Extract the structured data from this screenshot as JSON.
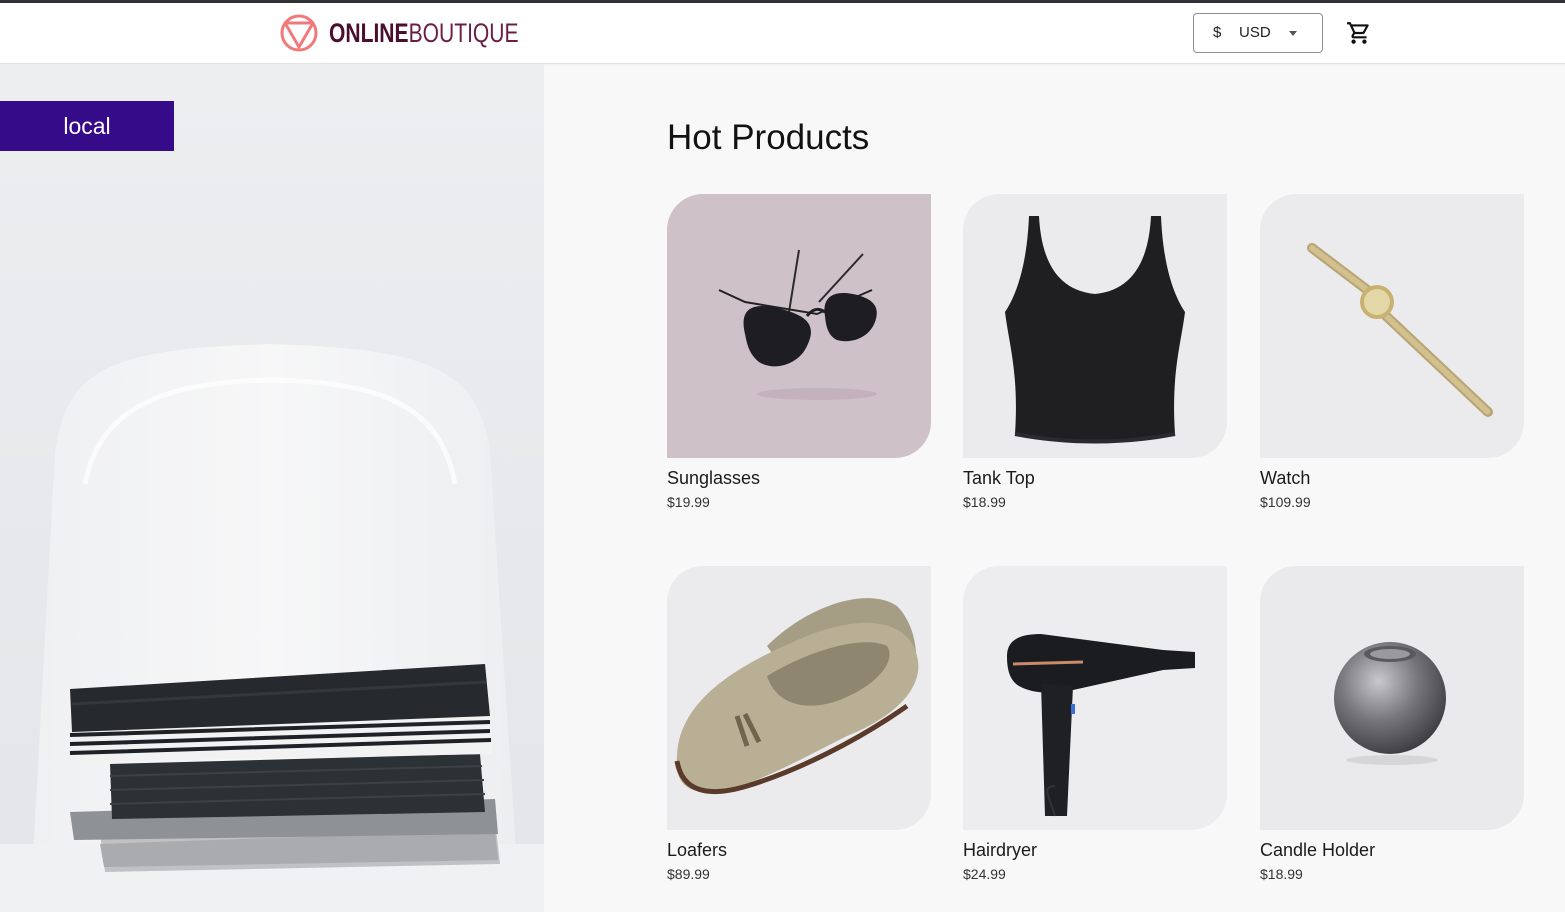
{
  "header": {
    "logo": {
      "strong": "ONLINE",
      "light": "BOUTIQUE",
      "icon": "triangle-circle-logo-icon"
    },
    "currency": {
      "symbol": "$",
      "code": "USD",
      "icon": "chevron-down-icon"
    },
    "cart": {
      "icon": "cart-icon"
    }
  },
  "env_badge": "local",
  "section_title": "Hot Products",
  "products": [
    {
      "name": "Sunglasses",
      "price": "$19.99",
      "icon": "sunglasses-icon"
    },
    {
      "name": "Tank Top",
      "price": "$18.99",
      "icon": "tank-top-icon"
    },
    {
      "name": "Watch",
      "price": "$109.99",
      "icon": "watch-icon"
    },
    {
      "name": "Loafers",
      "price": "$89.99",
      "icon": "loafers-icon"
    },
    {
      "name": "Hairdryer",
      "price": "$24.99",
      "icon": "hairdryer-icon"
    },
    {
      "name": "Candle Holder",
      "price": "$18.99",
      "icon": "candle-holder-icon"
    }
  ],
  "colors": {
    "accent": "#360b8a",
    "logo": "#4a0f2f",
    "logo_mark": "#f07a7a",
    "page_bg": "#f8f8f8"
  }
}
